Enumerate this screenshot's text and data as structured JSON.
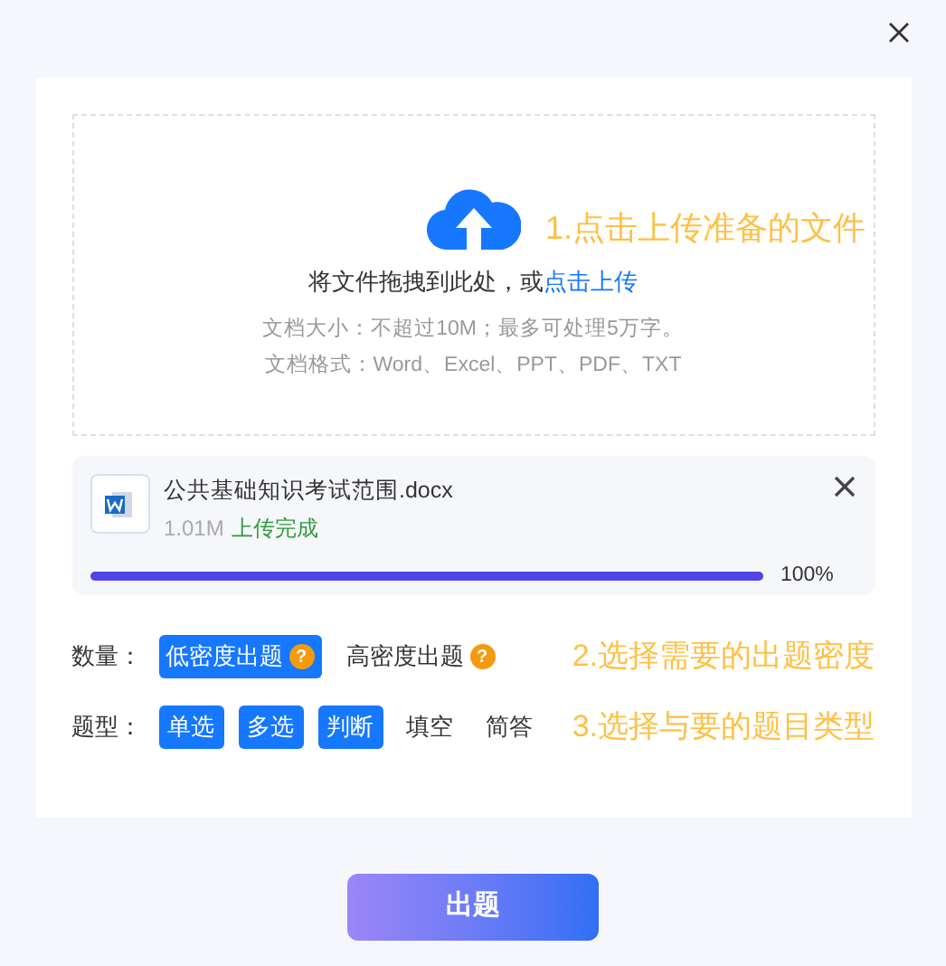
{
  "dropzone": {
    "prompt": "将文件拖拽到此处，或",
    "link": "点击上传",
    "hints": [
      "文档大小：不超过10M；最多可处理5万字。",
      "文档格式：Word、Excel、PPT、PDF、TXT"
    ],
    "annotation": "1.点击上传准备的文件"
  },
  "file": {
    "name": "公共基础知识考试范围.docx",
    "size": "1.01M",
    "status": "上传完成",
    "level": 1,
    "percent": "100%"
  },
  "density": {
    "label": "数量：",
    "options": [
      {
        "label": "低密度出题",
        "help": "?",
        "selected": true
      },
      {
        "label": "高密度出题",
        "help": "?",
        "selected": false
      }
    ],
    "annotation": "2.选择需要的出题密度"
  },
  "types": {
    "label": "题型：",
    "options": [
      {
        "label": "单选",
        "selected": true
      },
      {
        "label": "多选",
        "selected": true
      },
      {
        "label": "判断",
        "selected": true
      },
      {
        "label": "填空",
        "selected": false
      },
      {
        "label": "简答",
        "selected": false
      }
    ],
    "annotation": "3.选择与要的题目类型"
  },
  "submit": "出题"
}
